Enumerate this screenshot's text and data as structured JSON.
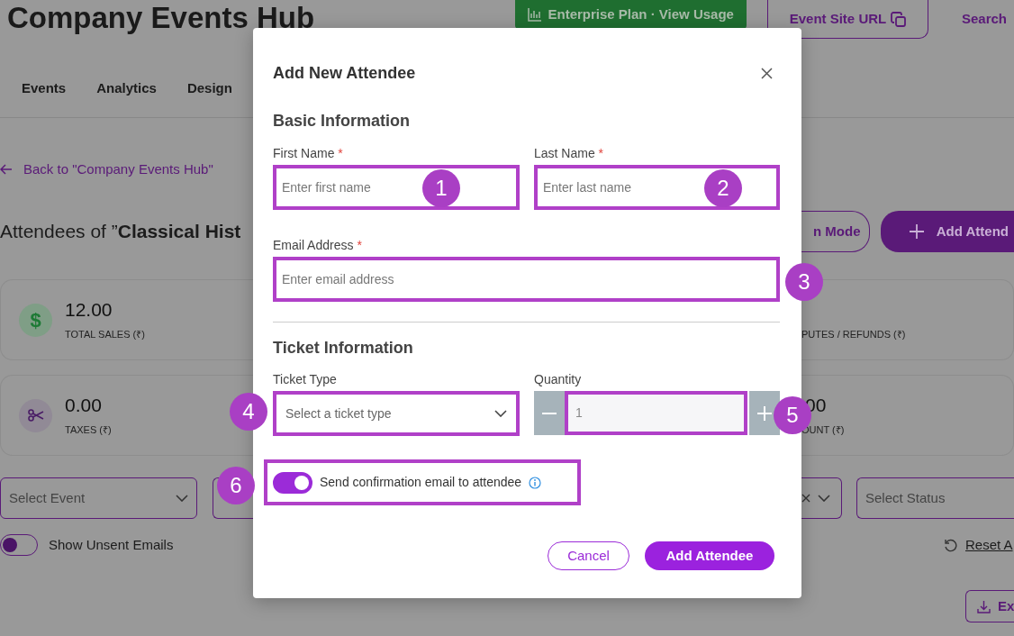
{
  "header": {
    "title": "Company Events Hub",
    "plan_button": "Enterprise Plan · View Usage",
    "site_url_button": "Event Site URL",
    "search_link": "Search"
  },
  "nav_tabs": [
    {
      "label": "Events",
      "selected": false
    },
    {
      "label": "Analytics",
      "selected": false
    },
    {
      "label": "Design",
      "selected": false
    }
  ],
  "back_link": "Back to \"Company Events Hub\"",
  "page_title": "Attendees of ”**Classical Hist**",
  "mode_button": "n Mode",
  "add_button": "Add Attend",
  "stats_left": [
    {
      "kind": "money",
      "symbol": "$",
      "value": "12.00",
      "label": "TOTAL SALES (₹)"
    },
    {
      "kind": "scissors",
      "value": "0.00",
      "label": "TAXES (₹)"
    }
  ],
  "stats_right": [
    {
      "label": "PUTES / REFUNDS (₹)"
    },
    {
      "value": "00",
      "label": "OUNT (₹)"
    }
  ],
  "filters": {
    "event_select": "Select Event",
    "status_select": "Select Status"
  },
  "unsent_toggle": {
    "label": "Show Unsent Emails",
    "on": false
  },
  "reset_link": "Reset A",
  "export_button": "Ex",
  "modal": {
    "title": "Add New Attendee",
    "basic_heading": "Basic Information",
    "first_name": {
      "label": "First Name",
      "required_mark": "*",
      "placeholder": "Enter first name",
      "callout": "1"
    },
    "last_name": {
      "label": "Last Name",
      "required_mark": "*",
      "placeholder": "Enter last name",
      "callout": "2"
    },
    "email": {
      "label": "Email Address",
      "required_mark": "*",
      "placeholder": "Enter email address",
      "callout": "3"
    },
    "ticket_heading": "Ticket Information",
    "ticket_type": {
      "label": "Ticket Type",
      "placeholder": "Select a ticket type",
      "callout": "4"
    },
    "quantity": {
      "label": "Quantity",
      "value": "1",
      "disabled": true,
      "callout": "5"
    },
    "confirmation": {
      "label": "Send confirmation email to attendee",
      "on": true,
      "callout": "6"
    },
    "cancel_button": "Cancel",
    "submit_button": "Add Attendee"
  }
}
